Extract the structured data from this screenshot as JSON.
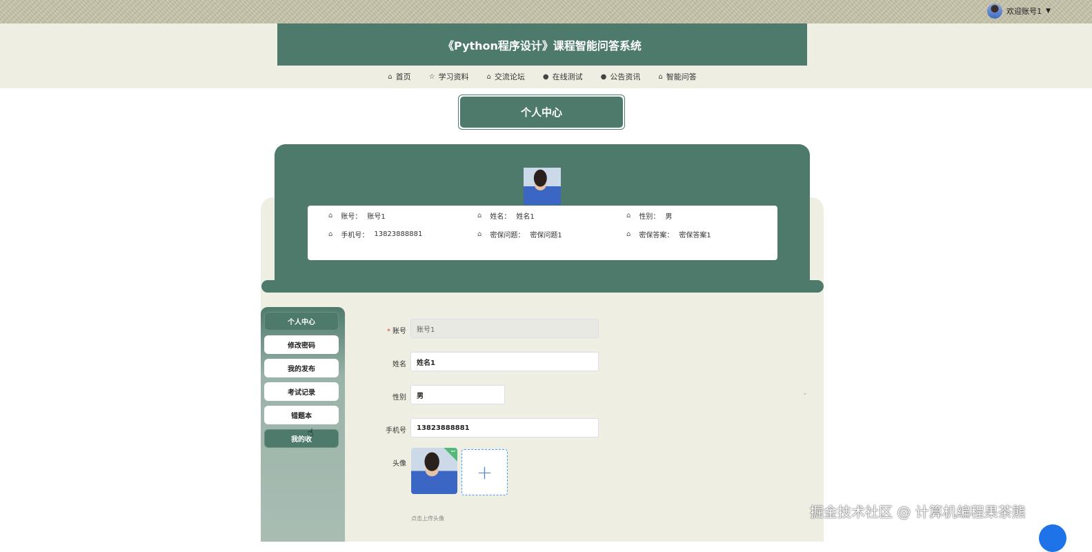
{
  "header": {
    "welcome": "欢迎账号1",
    "site_title": "《Python程序设计》课程智能问答系统"
  },
  "nav": [
    {
      "icon": "home-icon",
      "label": "首页"
    },
    {
      "icon": "star-icon",
      "label": "学习资料"
    },
    {
      "icon": "lock-icon",
      "label": "交流论坛"
    },
    {
      "icon": "info-icon",
      "label": "在线测试"
    },
    {
      "icon": "question-icon",
      "label": "公告资讯"
    },
    {
      "icon": "home-icon",
      "label": "智能问答"
    }
  ],
  "section_title": "个人中心",
  "profile_info": {
    "account_label": "账号：",
    "account_value": "账号1",
    "name_label": "姓名：",
    "name_value": "姓名1",
    "gender_label": "性别：",
    "gender_value": "男",
    "phone_label": "手机号：",
    "phone_value": "13823888881",
    "question_label": "密保问题：",
    "question_value": "密保问题1",
    "answer_label": "密保答案：",
    "answer_value": "密保答案1"
  },
  "side_menu": [
    {
      "label": "个人中心",
      "active": true
    },
    {
      "label": "修改密码",
      "active": false
    },
    {
      "label": "我的发布",
      "active": false
    },
    {
      "label": "考试记录",
      "active": false
    },
    {
      "label": "错题本",
      "active": false
    },
    {
      "label": "我的收",
      "active": true
    }
  ],
  "form": {
    "account_label": "账号",
    "account_value": "账号1",
    "name_label": "姓名",
    "name_value": "姓名1",
    "gender_label": "性别",
    "gender_value": "男",
    "phone_label": "手机号",
    "phone_value": "13823888881",
    "avatar_label": "头像",
    "upload_plus": "+",
    "upload_hint": "点击上传头像"
  },
  "watermark": "掘金技术社区 @ 计算机编程果茶熊",
  "colors": {
    "primary": "#4e7a6c",
    "band": "#eeeee3"
  }
}
